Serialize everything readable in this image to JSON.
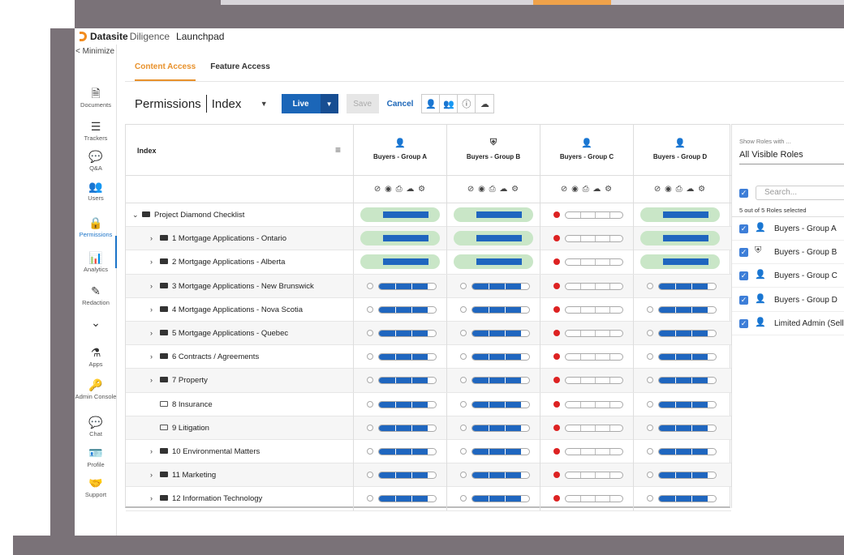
{
  "app": {
    "brand": "Datasite",
    "product": "Diligence",
    "section": "Launchpad"
  },
  "sidebar": {
    "minimize": "< Minimize",
    "items": [
      {
        "label": "Documents",
        "icon": "document-icon",
        "glyph": "🗎"
      },
      {
        "label": "Trackers",
        "icon": "trackers-icon",
        "glyph": "☰"
      },
      {
        "label": "Q&A",
        "icon": "qa-icon",
        "glyph": "💬"
      },
      {
        "label": "Users",
        "icon": "users-icon",
        "glyph": "👥"
      },
      {
        "label": "Permissions",
        "icon": "lock-icon",
        "glyph": "🔒"
      },
      {
        "label": "Analytics",
        "icon": "analytics-icon",
        "glyph": "📊"
      },
      {
        "label": "Redaction",
        "icon": "redaction-icon",
        "glyph": "✎"
      },
      {
        "label": "",
        "icon": "more-icon",
        "glyph": "⌄"
      },
      {
        "label": "Apps",
        "icon": "flask-icon",
        "glyph": "⚗"
      },
      {
        "label": "Admin Console",
        "icon": "key-icon",
        "glyph": "🔑"
      },
      {
        "label": "Chat",
        "icon": "chat-icon",
        "glyph": "💬"
      },
      {
        "label": "Profile",
        "icon": "profile-icon",
        "glyph": "🪪"
      },
      {
        "label": "Support",
        "icon": "support-icon",
        "glyph": "🤝"
      }
    ],
    "active": "Permissions"
  },
  "tabs": [
    {
      "label": "Content Access",
      "active": true
    },
    {
      "label": "Feature Access",
      "active": false
    }
  ],
  "toolbar": {
    "title": "Permissions",
    "index_label": "Index",
    "live_label": "Live",
    "save_label": "Save",
    "cancel_label": "Cancel"
  },
  "grid": {
    "index_header": "Index",
    "columns": [
      "Buyers - Group A",
      "Buyers - Group B",
      "Buyers - Group C",
      "Buyers - Group D"
    ],
    "perm_icons": "⊘ ◉ ⎙ ☁ ⚙",
    "rows": [
      {
        "label": "Project Diamond Checklist",
        "level": 0,
        "chevron": "⌄",
        "folder": "root",
        "states": [
          "full",
          "full",
          "dot",
          "full"
        ]
      },
      {
        "label": "1 Mortgage Applications - Ontario",
        "level": 1,
        "chevron": "›",
        "folder": "closed",
        "states": [
          "full",
          "full",
          "dot",
          "full"
        ]
      },
      {
        "label": "2 Mortgage Applications - Alberta",
        "level": 1,
        "chevron": "›",
        "folder": "closed",
        "states": [
          "full",
          "full",
          "dot",
          "full"
        ]
      },
      {
        "label": "3 Mortgage Applications - New Brunswick",
        "level": 1,
        "chevron": "›",
        "folder": "closed",
        "states": [
          "partial",
          "partial",
          "dot",
          "partial"
        ]
      },
      {
        "label": "4 Mortgage Applications - Nova Scotia",
        "level": 1,
        "chevron": "›",
        "folder": "closed",
        "states": [
          "partial",
          "partial",
          "dot",
          "partial"
        ]
      },
      {
        "label": "5 Mortgage Applications - Quebec",
        "level": 1,
        "chevron": "›",
        "folder": "closed",
        "states": [
          "partial",
          "partial",
          "dot",
          "partial"
        ]
      },
      {
        "label": "6 Contracts / Agreements",
        "level": 1,
        "chevron": "›",
        "folder": "closed",
        "states": [
          "partial",
          "partial",
          "dot",
          "partial"
        ]
      },
      {
        "label": "7 Property",
        "level": 1,
        "chevron": "›",
        "folder": "closed",
        "states": [
          "partial",
          "partial",
          "dot",
          "partial"
        ]
      },
      {
        "label": "8 Insurance",
        "level": 1,
        "chevron": "",
        "folder": "open",
        "states": [
          "partial",
          "partial",
          "dot",
          "partial"
        ]
      },
      {
        "label": "9 Litigation",
        "level": 1,
        "chevron": "",
        "folder": "open",
        "states": [
          "partial",
          "partial",
          "dot",
          "partial"
        ]
      },
      {
        "label": "10 Environmental Matters",
        "level": 1,
        "chevron": "›",
        "folder": "closed",
        "states": [
          "partial",
          "partial",
          "dot",
          "partial"
        ]
      },
      {
        "label": "11 Marketing",
        "level": 1,
        "chevron": "›",
        "folder": "closed",
        "states": [
          "partial",
          "partial",
          "dot",
          "partial"
        ]
      },
      {
        "label": "12 Information Technology",
        "level": 1,
        "chevron": "›",
        "folder": "closed",
        "states": [
          "partial",
          "partial",
          "dot",
          "partial"
        ]
      }
    ]
  },
  "roles_panel": {
    "show_label": "Show Roles with ...",
    "show_value": "All Visible Roles",
    "search_placeholder": "Search...",
    "count_text": "5 out of 5 Roles selected",
    "roles": [
      "Buyers - Group A",
      "Buyers - Group B",
      "Buyers - Group C",
      "Buyers - Group D",
      "Limited Admin (Sell"
    ]
  },
  "colors": {
    "accent": "#e8912b",
    "primary": "#1b66b8",
    "fill": "#1f66bf",
    "full_bg": "#c9e6c7",
    "deny": "#dd2222"
  }
}
